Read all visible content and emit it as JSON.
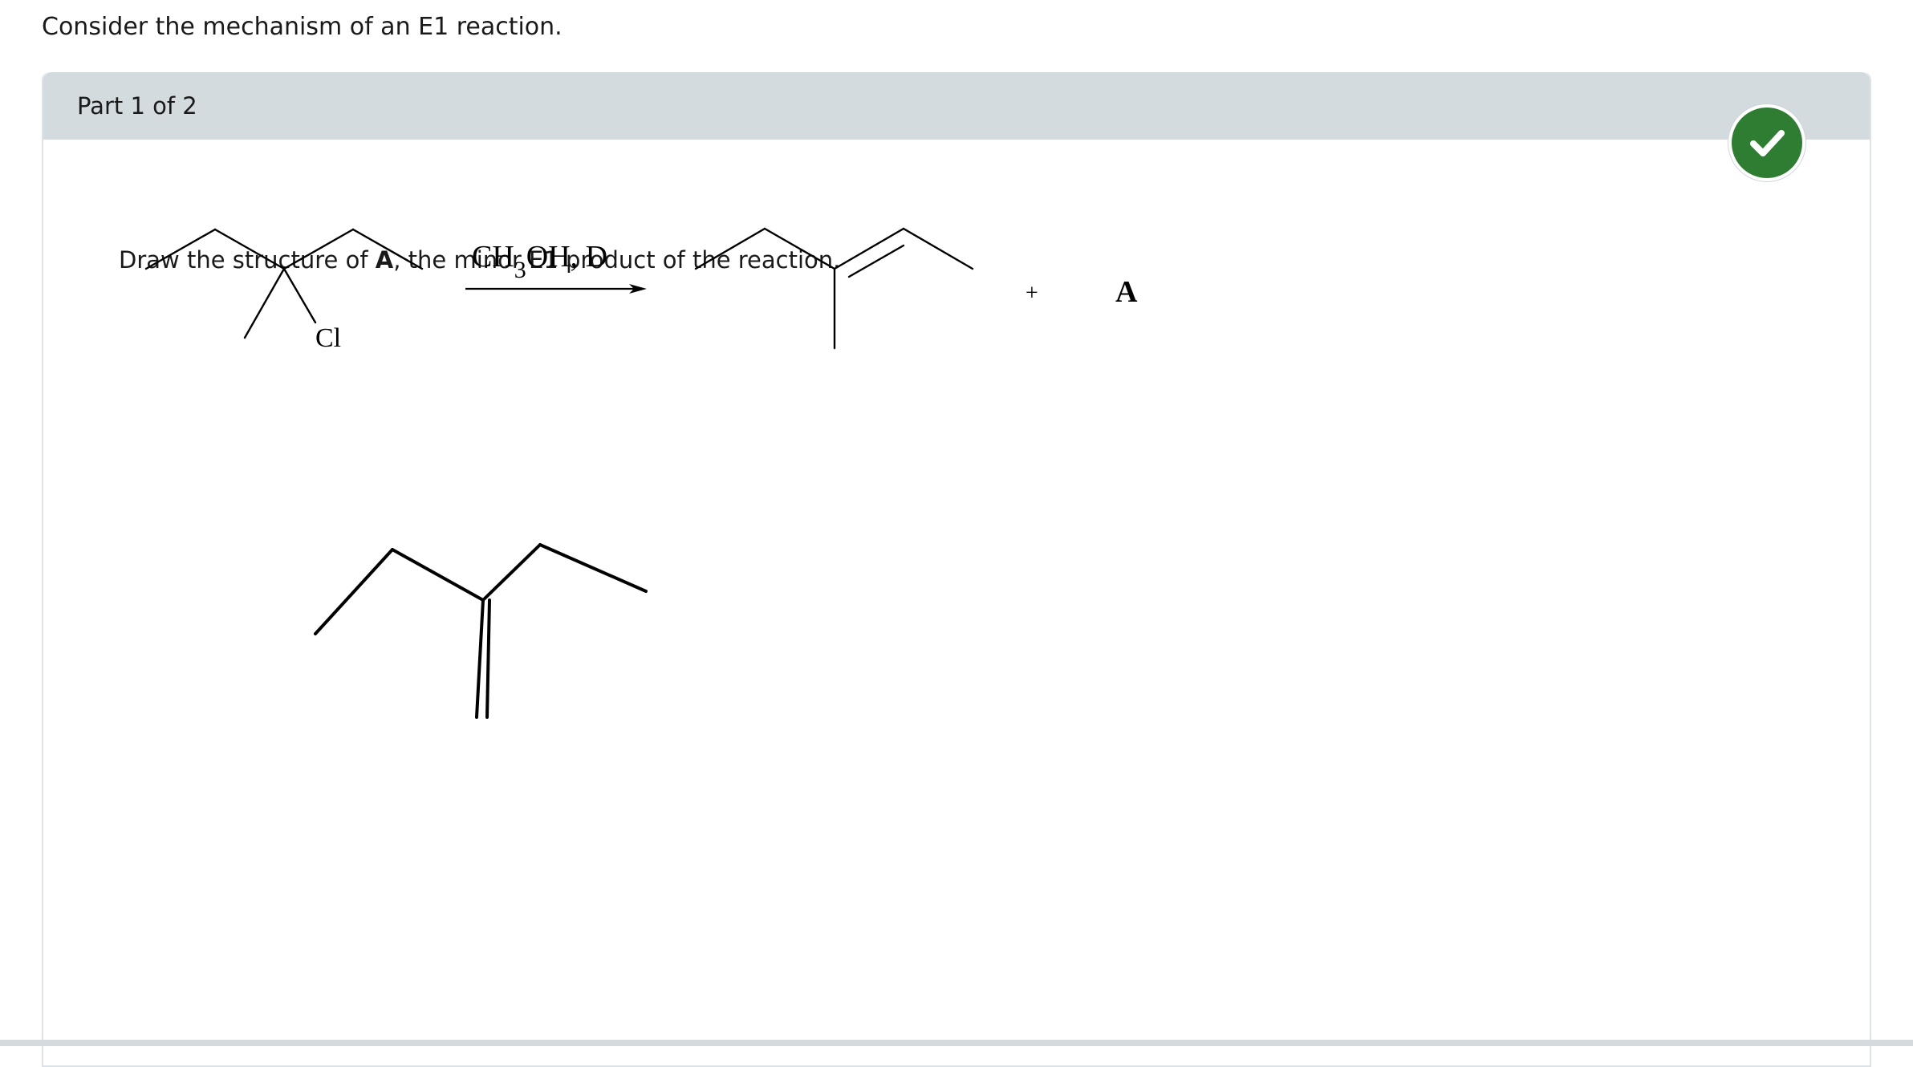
{
  "question": {
    "intro": "Consider the mechanism of an E1 reaction."
  },
  "part": {
    "title": "Part 1 of 2",
    "status": "correct",
    "status_color": "#2e7d32",
    "prompt_before": "Draw the structure of ",
    "prompt_bold": "A",
    "prompt_after": ", the minor E1 product of the reaction."
  },
  "reaction": {
    "reactant_substituent": "Cl",
    "reagent_main": "CH",
    "reagent_sub": "3",
    "reagent_rest": "OH, D",
    "plus": "+",
    "product_label": "A"
  },
  "icons": {
    "status_icon": "check-icon"
  }
}
